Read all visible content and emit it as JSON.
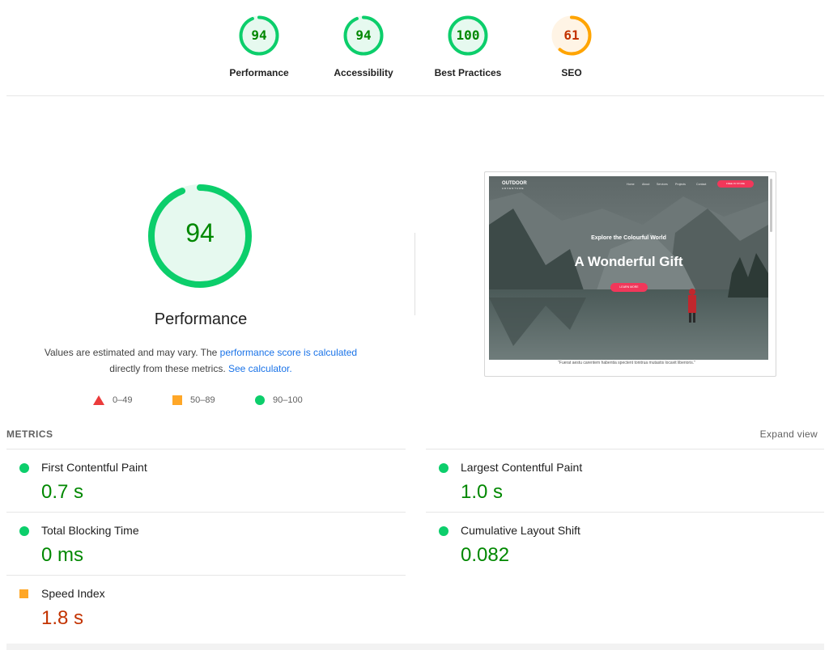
{
  "categories": [
    {
      "label": "Performance",
      "score": 94,
      "fraction": 0.94,
      "color": "#0cce6b",
      "fill": "#e6f9ef",
      "text_color": "#008800"
    },
    {
      "label": "Accessibility",
      "score": 94,
      "fraction": 0.94,
      "color": "#0cce6b",
      "fill": "#e6f9ef",
      "text_color": "#008800"
    },
    {
      "label": "Best Practices",
      "score": 100,
      "fraction": 1.0,
      "color": "#0cce6b",
      "fill": "#e6f9ef",
      "text_color": "#008800"
    },
    {
      "label": "SEO",
      "score": 61,
      "fraction": 0.61,
      "color": "#ffa400",
      "fill": "#fff4e5",
      "text_color": "#c33300"
    }
  ],
  "performance": {
    "score": 94,
    "fraction": 0.94,
    "title": "Performance",
    "desc_prefix": "Values are estimated and may vary. The ",
    "desc_link1": "performance score is calculated",
    "desc_middle": " directly from these metrics.",
    "desc_link2": "See calculator."
  },
  "legend": [
    {
      "range": "0–49",
      "shape": "triangle",
      "color": "#eb3b3b"
    },
    {
      "range": "50–89",
      "shape": "square",
      "color": "#ffa727"
    },
    {
      "range": "90–100",
      "shape": "circle",
      "color": "#0cce6b"
    }
  ],
  "screenshot": {
    "brand": "OUTDOOR",
    "brand_sub": "ADVENTURE",
    "nav": [
      "Home",
      "About",
      "Services",
      "Projects",
      "Contact"
    ],
    "nav_cta": "FREE IN STORE",
    "eyebrow": "Explore the Colourful World",
    "headline": "A Wonderful Gift",
    "hero_button": "LEARN MORE",
    "quote": "\"Fuerat aestu carentem habentia spectent tonitrua mutastis locavit liberioris.\""
  },
  "metrics": {
    "heading": "METRICS",
    "expand_label": "Expand view",
    "items": [
      {
        "label": "First Contentful Paint",
        "value": "0.7 s",
        "status": "good"
      },
      {
        "label": "Largest Contentful Paint",
        "value": "1.0 s",
        "status": "good"
      },
      {
        "label": "Total Blocking Time",
        "value": "0 ms",
        "status": "good"
      },
      {
        "label": "Cumulative Layout Shift",
        "value": "0.082",
        "status": "good"
      },
      {
        "label": "Speed Index",
        "value": "1.8 s",
        "status": "average"
      }
    ]
  }
}
